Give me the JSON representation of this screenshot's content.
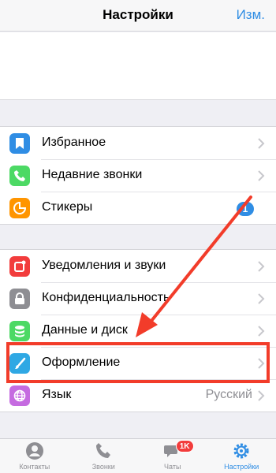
{
  "header": {
    "title": "Настройки",
    "edit_label": "Изм."
  },
  "groups": [
    {
      "items": [
        {
          "label": "Избранное",
          "icon": "bookmark-icon",
          "color": "#2f8de4"
        },
        {
          "label": "Недавние звонки",
          "icon": "phone-icon",
          "color": "#4cd964"
        },
        {
          "label": "Стикеры",
          "icon": "sticker-icon",
          "color": "#ff9500",
          "badge": "1"
        }
      ]
    },
    {
      "items": [
        {
          "label": "Уведомления и звуки",
          "icon": "notification-icon",
          "color": "#f23c3c"
        },
        {
          "label": "Конфиденциальность",
          "icon": "lock-icon",
          "color": "#8e8e93"
        },
        {
          "label": "Данные и диск",
          "icon": "database-icon",
          "color": "#4cd964"
        },
        {
          "label": "Оформление",
          "icon": "brush-icon",
          "color": "#2fa8e4"
        },
        {
          "label": "Язык",
          "icon": "globe-icon",
          "color": "#c56be0",
          "value": "Русский"
        }
      ]
    }
  ],
  "tabbar": {
    "tabs": [
      {
        "label": "Контакты",
        "icon": "person-icon"
      },
      {
        "label": "Звонки",
        "icon": "phone-icon"
      },
      {
        "label": "Чаты",
        "icon": "chat-icon",
        "badge": "1K"
      },
      {
        "label": "Настройки",
        "icon": "gear-icon",
        "active": true
      }
    ]
  },
  "annotation": {
    "color": "#f23c2a",
    "highlighted_item": "Оформление"
  },
  "colors": {
    "accent": "#2f8de4",
    "background": "#efeff4"
  }
}
